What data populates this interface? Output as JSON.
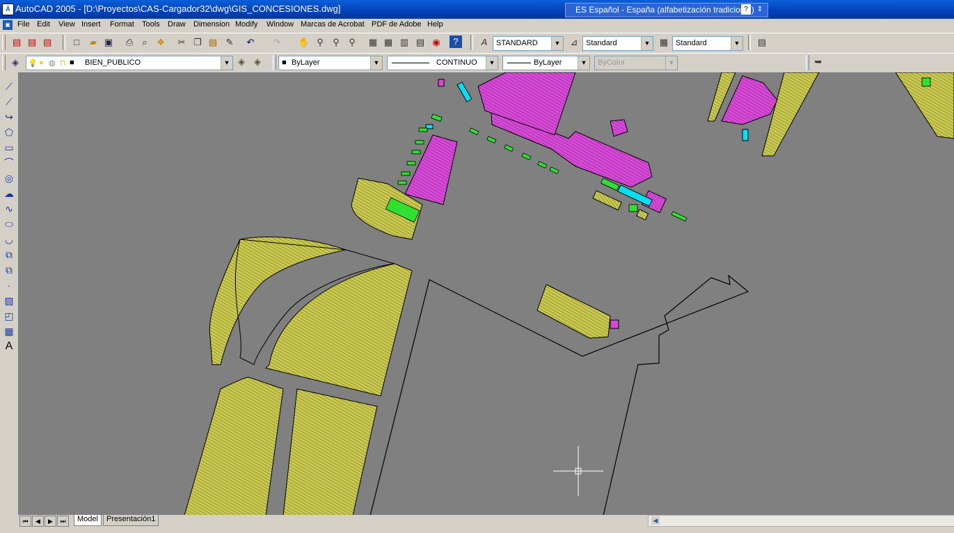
{
  "window": {
    "title": "AutoCAD 2005 - [D:\\Proyectos\\CAS-Cargador32\\dwg\\GIS_CONCESIONES.dwg]",
    "language_bar": "ES Español - España (alfabetización tradicional)"
  },
  "menu": [
    "File",
    "Edit",
    "View",
    "Insert",
    "Format",
    "Tools",
    "Draw",
    "Dimension",
    "Modify",
    "Window",
    "Marcas de Acrobat",
    "PDF de Adobe",
    "Help"
  ],
  "toolbar_standard": {
    "text_style": "STANDARD",
    "dim_style": "Standard",
    "table_style": "Standard"
  },
  "toolbar_layers": {
    "current_layer": "BIEN_PUBLICO",
    "color": "ByLayer",
    "linetype": "CONTINUO",
    "lineweight": "ByLayer",
    "plot_style": "ByColor"
  },
  "layout_tabs": [
    "Model",
    "Presentación1"
  ],
  "icons": {
    "top": [
      "pdf-icon",
      "pdf-mail-icon",
      "pdf-review-icon",
      "new-icon",
      "open-icon",
      "save-icon",
      "print-icon",
      "print-preview-icon",
      "publish-icon",
      "cut-icon",
      "copy-icon",
      "paste-icon",
      "match-properties-icon",
      "undo-icon",
      "redo-icon",
      "pan-icon",
      "zoom-realtime-icon",
      "zoom-window-icon",
      "zoom-previous-icon",
      "properties-icon",
      "design-center-icon",
      "tool-palettes-icon",
      "sheet-set-icon",
      "markup-icon",
      "help-icon"
    ],
    "left": [
      "line-icon",
      "construction-line-icon",
      "polyline-icon",
      "polygon-icon",
      "rectangle-icon",
      "arc-icon",
      "circle-icon",
      "revision-cloud-icon",
      "spline-icon",
      "ellipse-icon",
      "ellipse-arc-icon",
      "insert-block-icon",
      "make-block-icon",
      "point-icon",
      "hatch-icon",
      "region-icon",
      "table-icon",
      "multiline-text-icon"
    ]
  },
  "colors": {
    "canvas": "#808080",
    "hatch_yellow": "#c8c850",
    "hatch_magenta": "#d040d0",
    "cyan": "#00e0f0",
    "green": "#30e030",
    "titlebar": "#0a5fd8"
  }
}
